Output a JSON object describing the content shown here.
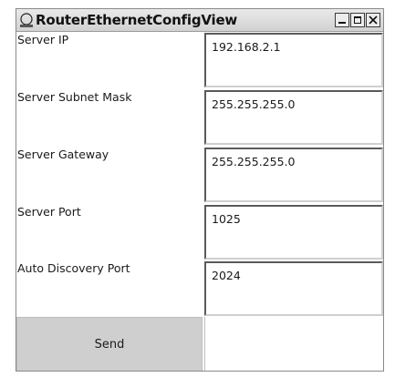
{
  "window": {
    "title": "RouterEthernetConfigView",
    "icon": "app-icon"
  },
  "fields": [
    {
      "label": "Server IP",
      "value": "192.168.2.1"
    },
    {
      "label": "Server Subnet Mask",
      "value": "255.255.255.0"
    },
    {
      "label": "Server Gateway",
      "value": "255.255.255.0"
    },
    {
      "label": "Server Port",
      "value": "1025"
    },
    {
      "label": "Auto Discovery Port",
      "value": "2024"
    }
  ],
  "actions": {
    "send_label": "Send"
  },
  "colors": {
    "button_bg": "#cfcfcf",
    "titlebar_bg": "#dcdcdc"
  }
}
